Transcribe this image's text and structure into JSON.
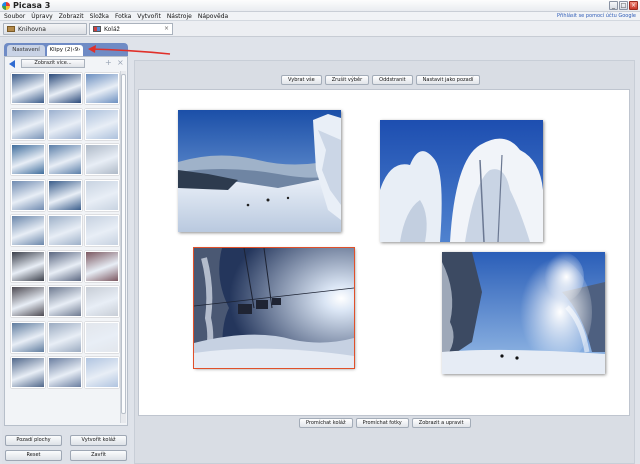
{
  "window": {
    "title": "Picasa 3"
  },
  "menu": {
    "items": [
      "Soubor",
      "Úpravy",
      "Zobrazit",
      "Složka",
      "Fotka",
      "Vytvořit",
      "Nástroje",
      "Nápověda"
    ],
    "signin": "Přihlásit se pomocí účtu Google"
  },
  "toolbar": {
    "library_tab": "Knihovna",
    "collage_tab": "Koláž",
    "collage_close": "×"
  },
  "panel": {
    "settings_tab": "Nastavení",
    "clips_tab": "Klipy (2)‹9›",
    "show_more": "Zobrazit více...",
    "plus": "+",
    "close": "×",
    "thumbnails": [
      "#3c5c8a",
      "#2b4a7a",
      "#6c8fc0",
      "#7b95b9",
      "#9bb0cf",
      "#adc1dc",
      "#3f6d9c",
      "#5a7ea8",
      "#aeb9c7",
      "#6f8ab0",
      "#3a5d8b",
      "#c8d3e1",
      "#6a86aa",
      "#9db0c8",
      "#c6d1e0",
      "#3b3f4a",
      "#5a6680",
      "#7b5760",
      "#4d4a52",
      "#6e7a90",
      "#c7cdd6",
      "#5f7c9e",
      "#9aaac0",
      "#e2e6ec",
      "#50678a",
      "#6a7ea0",
      "#b0c4e0"
    ],
    "buttons": {
      "background": "Pozadí plochy",
      "create": "Vytvořit koláž",
      "reset": "Reset",
      "close": "Zavřít"
    }
  },
  "collage": {
    "top_buttons": [
      "Vybrat vše",
      "Zrušit výběr",
      "Oddstranit",
      "Nastavit jako pozadí"
    ],
    "bottom_buttons": [
      "Promíchat koláž",
      "Promíchat fotky",
      "Zobrazit a upravit"
    ]
  },
  "colors": {
    "accent": "#6f8bc5",
    "selection": "#e0502a",
    "arrow": "#e0302a"
  }
}
